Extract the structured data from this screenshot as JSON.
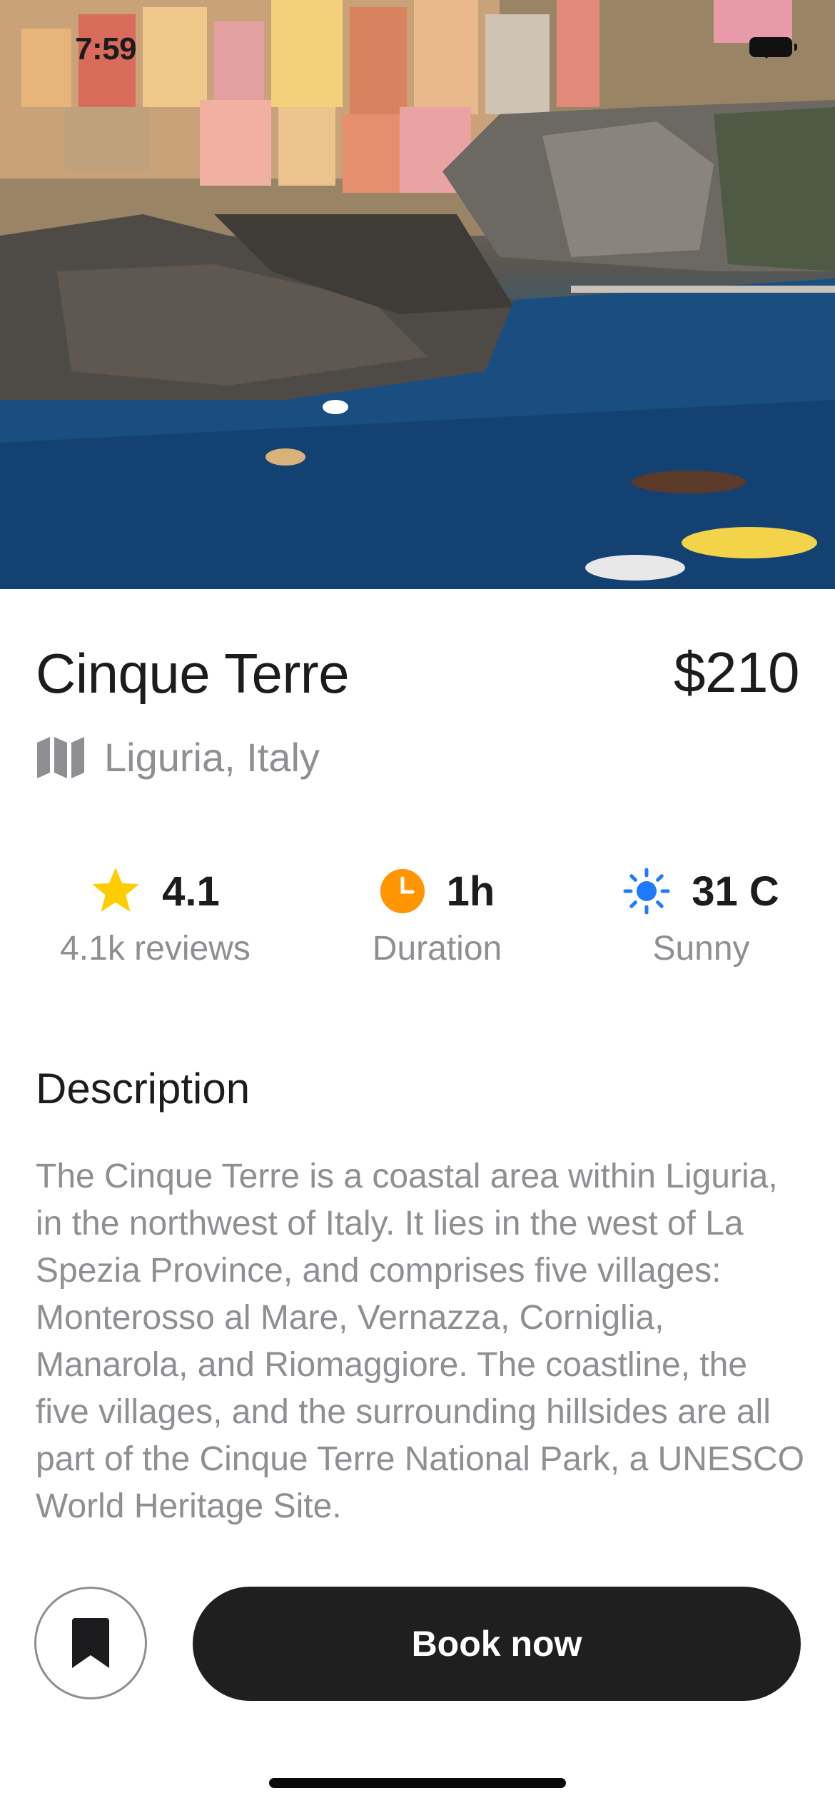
{
  "status_bar": {
    "time": "7:59"
  },
  "hero": {
    "image_icon": "photo-cinque-terre"
  },
  "place": {
    "name": "Cinque Terre",
    "price": "$210",
    "location": "Liguria, Italy",
    "location_icon": "map-icon"
  },
  "stats": {
    "rating": {
      "value": "4.1",
      "caption": "4.1k reviews",
      "icon": "star-icon",
      "color": "#FFCC00"
    },
    "duration": {
      "value": "1h",
      "caption": "Duration",
      "icon": "clock-icon",
      "color": "#FF9500"
    },
    "weather": {
      "value": "31 C",
      "caption": "Sunny",
      "icon": "sun-icon",
      "color": "#1E7BFF"
    }
  },
  "description": {
    "heading": "Description",
    "body": "The Cinque Terre is a coastal area within Liguria, in the northwest of Italy. It lies in the west of La Spezia Province, and comprises five villages: Monterosso al Mare, Vernazza, Corniglia, Manarola, and Riomaggiore. The coastline, the five villages, and the surrounding hillsides are all part of the Cinque Terre National Park, a UNESCO World Heritage Site."
  },
  "actions": {
    "bookmark_icon": "bookmark-icon",
    "book_label": "Book now",
    "primary_color": "#1F1F1F"
  }
}
